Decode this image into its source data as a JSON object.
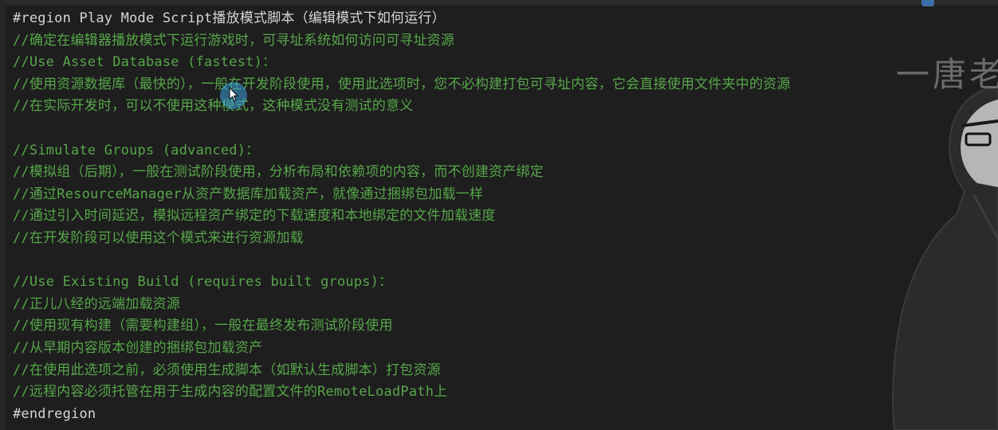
{
  "editor": {
    "lines": [
      {
        "kind": "region",
        "text": "#region Play Mode Script播放模式脚本（编辑模式下如何运行）"
      },
      {
        "kind": "comment",
        "text": "//确定在编辑器播放模式下运行游戏时，可寻址系统如何访问可寻址资源"
      },
      {
        "kind": "comment",
        "text": "//Use Asset Database (fastest)："
      },
      {
        "kind": "comment",
        "text": "//使用资源数据库（最快的），一般在开发阶段使用，使用此选项时，您不必构建打包可寻址内容，它会直接使用文件夹中的资源"
      },
      {
        "kind": "comment",
        "text": "//在实际开发时，可以不使用这种模式，这种模式没有测试的意义"
      },
      {
        "kind": "blank",
        "text": ""
      },
      {
        "kind": "comment",
        "text": "//Simulate Groups (advanced)："
      },
      {
        "kind": "comment",
        "text": "//模拟组（后期），一般在测试阶段使用，分析布局和依赖项的内容，而不创建资产绑定"
      },
      {
        "kind": "comment",
        "text": "//通过ResourceManager从资产数据库加载资产，就像通过捆绑包加载一样"
      },
      {
        "kind": "comment",
        "text": "//通过引入时间延迟，模拟远程资产绑定的下载速度和本地绑定的文件加载速度"
      },
      {
        "kind": "comment",
        "text": "//在开发阶段可以使用这个模式来进行资源加载"
      },
      {
        "kind": "blank",
        "text": ""
      },
      {
        "kind": "comment",
        "text": "//Use Existing Build (requires built groups)："
      },
      {
        "kind": "comment",
        "text": "//正儿八经的远端加载资源"
      },
      {
        "kind": "comment",
        "text": "//使用现有构建（需要构建组），一般在最终发布测试阶段使用"
      },
      {
        "kind": "comment",
        "text": "//从早期内容版本创建的捆绑包加载资产"
      },
      {
        "kind": "comment",
        "text": "//在使用此选项之前，必须使用生成脚本（如默认生成脚本）打包资源"
      },
      {
        "kind": "comment",
        "text": "//远程内容必须托管在用于生成内容的配置文件的RemoteLoadPath上"
      },
      {
        "kind": "region",
        "text": "#endregion"
      }
    ]
  },
  "overlay": {
    "watermark_text": "一唐老",
    "cursor_icon": "mouse-pointer-icon"
  },
  "colors": {
    "background": "#1e1e1e",
    "region": "#d6d6d6",
    "comment": "#57a64a"
  }
}
